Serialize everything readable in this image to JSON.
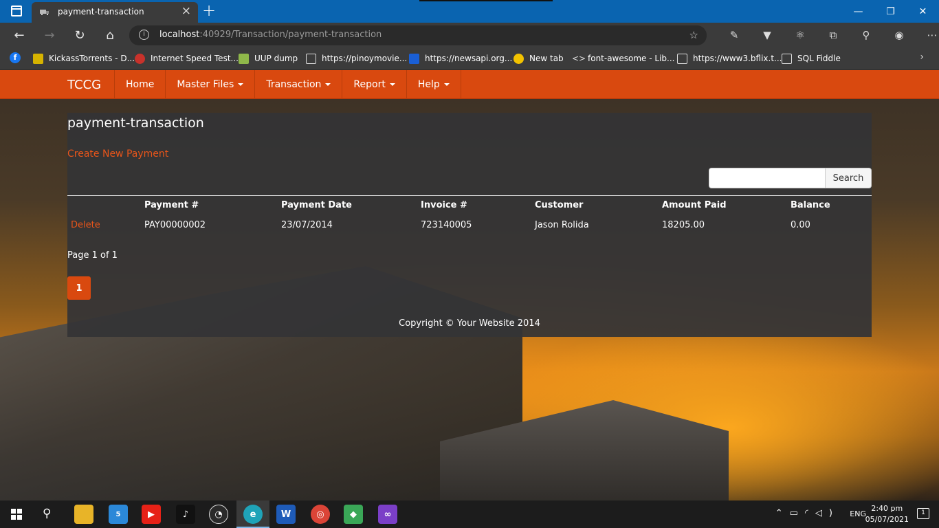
{
  "browser": {
    "tab_title": "payment-transaction",
    "url_host": "localhost",
    "url_rest": ":40929/Transaction/payment-transaction",
    "bookmarks": [
      {
        "label": "KickassTorrents - D...",
        "icon": "kickass-icon",
        "color": "#d6b300"
      },
      {
        "label": "Internet Speed Test...",
        "icon": "speedtest-icon",
        "color": "#c8322b"
      },
      {
        "label": "UUP dump",
        "icon": "uup-icon",
        "color": "#8fb84a"
      },
      {
        "label": "https://pinoymovie...",
        "icon": "page-icon",
        "color": "#3b3b3b"
      },
      {
        "label": "https://newsapi.org...",
        "icon": "newsapi-icon",
        "color": "#1a5fd6"
      },
      {
        "label": "New tab",
        "icon": "emoji-icon",
        "color": "#f2c200"
      },
      {
        "label": "font-awesome - Lib...",
        "icon": "code-icon",
        "color": "#3b3b3b"
      },
      {
        "label": "https://www3.bflix.t...",
        "icon": "page-icon",
        "color": "#3b3b3b"
      },
      {
        "label": "SQL Fiddle",
        "icon": "page-icon",
        "color": "#3b3b3b"
      }
    ]
  },
  "nav": {
    "brand": "TCCG",
    "items": [
      {
        "label": "Home",
        "dropdown": false
      },
      {
        "label": "Master Files",
        "dropdown": true
      },
      {
        "label": "Transaction",
        "dropdown": true
      },
      {
        "label": "Report",
        "dropdown": true
      },
      {
        "label": "Help",
        "dropdown": true
      }
    ]
  },
  "main": {
    "title": "payment-transaction",
    "create_link": "Create New Payment",
    "search_button": "Search",
    "search_value": "",
    "table": {
      "headers": [
        "Payment #",
        "Payment Date",
        "Invoice #",
        "Customer",
        "Amount Paid",
        "Balance"
      ],
      "rows": [
        {
          "action": "Delete",
          "payment_no": "PAY00000002",
          "payment_date": "23/07/2014",
          "invoice_no": "723140005",
          "customer": "Jason Rolida",
          "amount_paid": "18205.00",
          "balance": "0.00"
        }
      ]
    },
    "page_info": "Page 1 of 1",
    "pager": [
      "1"
    ],
    "copyright": "Copyright © Your Website 2014"
  },
  "taskbar": {
    "language": "ENG",
    "time": "2:40 pm",
    "date": "05/07/2021",
    "notifications": "1",
    "app_badge": "5"
  },
  "colors": {
    "accent": "#d9490f",
    "link": "#e8551a",
    "titlebar": "#0a64b0",
    "chrome": "#3b3b3b"
  }
}
